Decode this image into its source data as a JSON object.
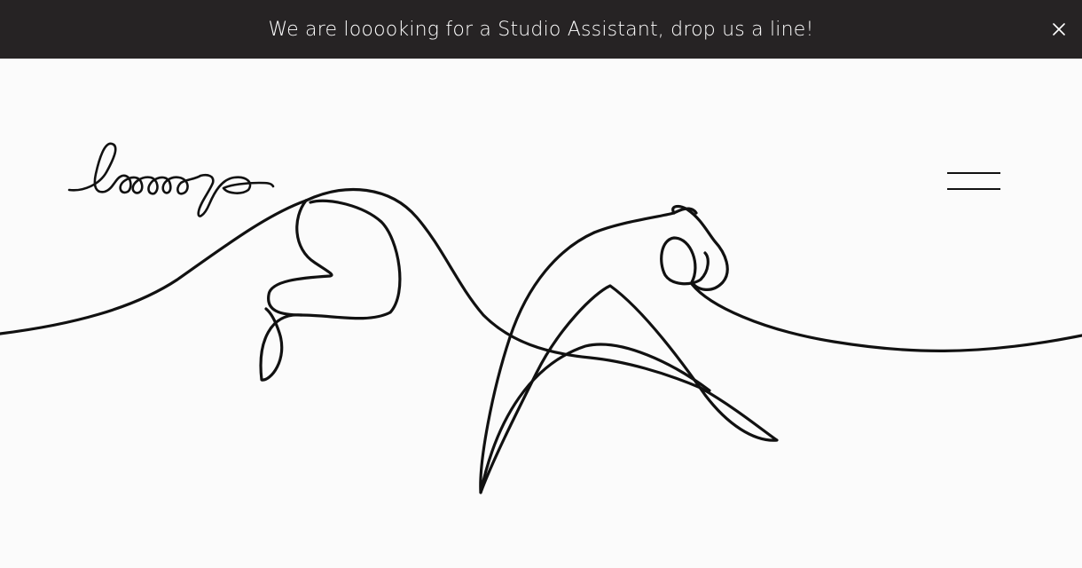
{
  "announcement": {
    "text": "We are looooking for a Studio Assistant, drop us a line!",
    "close_icon": "close-icon",
    "background": "#262324",
    "text_color": "#ffffff"
  },
  "header": {
    "logo_text": "looop",
    "menu_icon": "hamburger-menu-icon"
  },
  "hero": {
    "artwork": "continuous-line-art-cheetah",
    "background": "#fbfbfb",
    "line_color": "#111111"
  }
}
